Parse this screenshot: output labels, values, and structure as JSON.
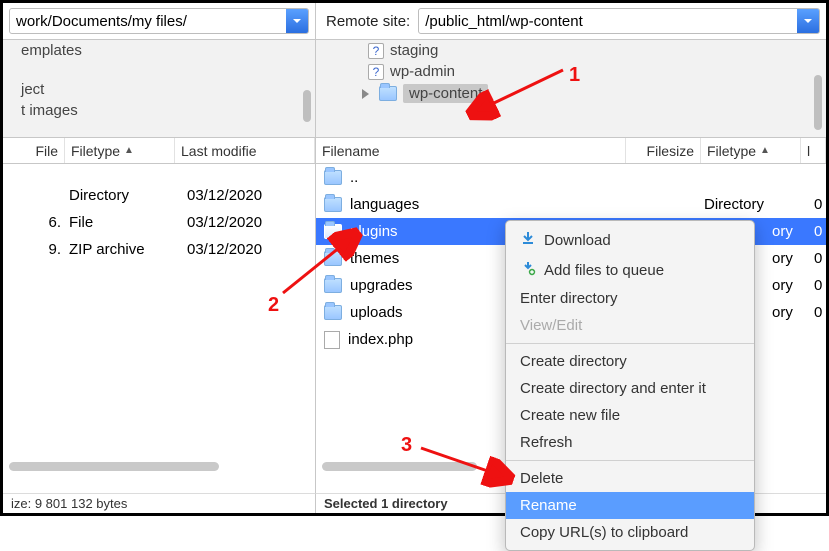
{
  "local": {
    "path": "work/Documents/my files/",
    "tree": [
      "emplates",
      "ject",
      "t images"
    ],
    "columns": {
      "file": "File",
      "filetype": "Filetype",
      "modified": "Last modifie"
    },
    "rows": [
      {
        "name": "",
        "type": "Directory",
        "modified": "03/12/2020"
      },
      {
        "name": "6.",
        "type": "File",
        "modified": "03/12/2020"
      },
      {
        "name": "9.",
        "type": "ZIP archive",
        "modified": "03/12/2020"
      }
    ],
    "status": "ize: 9 801 132 bytes"
  },
  "remote": {
    "label": "Remote site:",
    "path": "/public_html/wp-content",
    "tree": [
      {
        "icon": "q",
        "name": "staging"
      },
      {
        "icon": "q",
        "name": "wp-admin"
      },
      {
        "icon": "folder",
        "name": "wp-content",
        "selected": true,
        "expandable": true
      }
    ],
    "columns": {
      "filename": "Filename",
      "filesize": "Filesize",
      "filetype": "Filetype",
      "last": "l"
    },
    "rows": [
      {
        "icon": "folder",
        "name": "..",
        "type": "",
        "mod": ""
      },
      {
        "icon": "folder",
        "name": "languages",
        "type": "Directory",
        "mod": "0"
      },
      {
        "icon": "folder",
        "name": "plugins",
        "type": "ory",
        "mod": "0",
        "selected": true
      },
      {
        "icon": "folder",
        "name": "themes",
        "type": "ory",
        "mod": "0"
      },
      {
        "icon": "folder",
        "name": "upgrades",
        "type": "ory",
        "mod": "0"
      },
      {
        "icon": "folder",
        "name": "uploads",
        "type": "ory",
        "mod": "0"
      },
      {
        "icon": "file",
        "name": "index.php",
        "type": "",
        "mod": ""
      }
    ],
    "status": "Selected 1 directory"
  },
  "menu": {
    "download": "Download",
    "queue": "Add files to queue",
    "enter": "Enter directory",
    "viewedit": "View/Edit",
    "createdir": "Create directory",
    "createdirenter": "Create directory and enter it",
    "createfile": "Create new file",
    "refresh": "Refresh",
    "delete": "Delete",
    "rename": "Rename",
    "copyurl": "Copy URL(s) to clipboard"
  },
  "annotations": {
    "n1": "1",
    "n2": "2",
    "n3": "3"
  }
}
